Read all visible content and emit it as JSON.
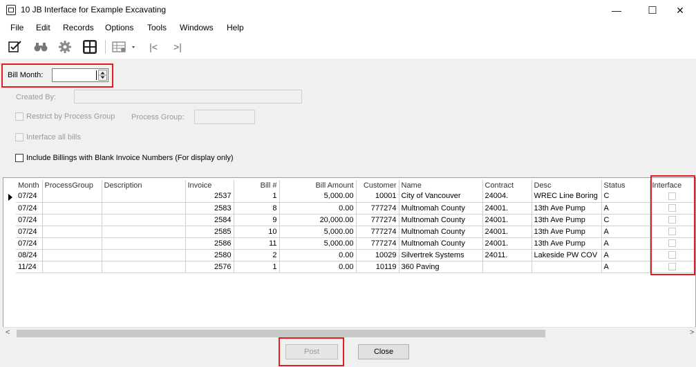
{
  "window": {
    "title": "10 JB Interface for Example Excavating",
    "minimize_glyph": "—",
    "maximize_glyph": "☐",
    "close_glyph": "✕"
  },
  "menu": [
    "File",
    "Edit",
    "Records",
    "Options",
    "Tools",
    "Windows",
    "Help"
  ],
  "toolbar": {
    "icons": [
      "edit-checklist-icon",
      "binoculars-icon",
      "gear-icon",
      "calculator-icon",
      "grid-settings-icon",
      "first-record-icon",
      "last-record-icon"
    ],
    "first_glyph": "|<",
    "last_glyph": ">|"
  },
  "form": {
    "bill_month_label": "Bill Month:",
    "bill_month_value": "",
    "created_by_label": "Created By:",
    "created_by_value": "",
    "restrict_label": "Restrict by Process Group",
    "process_group_label": "Process Group:",
    "process_group_value": "",
    "interface_all_label": "Interface all bills",
    "include_blank_label": "Include Billings with Blank Invoice Numbers  (For display only)"
  },
  "grid": {
    "columns": [
      "Month",
      "ProcessGroup",
      "Description",
      "Invoice",
      "Bill #",
      "Bill Amount",
      "Customer",
      "Name",
      "Contract",
      "Desc",
      "Status",
      "Interface"
    ],
    "rows": [
      [
        "07/24",
        "",
        "",
        "2537",
        "1",
        "5,000.00",
        "10001",
        "City of Vancouver",
        "24004.",
        "WREC Line Boring",
        "C"
      ],
      [
        "07/24",
        "",
        "",
        "2583",
        "8",
        "0.00",
        "777274",
        "Multnomah County",
        "24001.",
        "13th Ave Pump",
        "A"
      ],
      [
        "07/24",
        "",
        "",
        "2584",
        "9",
        "20,000.00",
        "777274",
        "Multnomah County",
        "24001.",
        "13th Ave Pump",
        "C"
      ],
      [
        "07/24",
        "",
        "",
        "2585",
        "10",
        "5,000.00",
        "777274",
        "Multnomah County",
        "24001.",
        "13th Ave Pump",
        "A"
      ],
      [
        "07/24",
        "",
        "",
        "2586",
        "11",
        "5,000.00",
        "777274",
        "Multnomah County",
        "24001.",
        "13th Ave Pump",
        "A"
      ],
      [
        "08/24",
        "",
        "",
        "2580",
        "2",
        "0.00",
        "10029",
        "Silvertrek Systems",
        "24011.",
        "Lakeside PW COV",
        "A"
      ],
      [
        "11/24",
        "",
        "",
        "2576",
        "1",
        "0.00",
        "10119",
        "360 Paving",
        "",
        "",
        "A"
      ]
    ],
    "scroll_left_glyph": "<",
    "scroll_right_glyph": ">"
  },
  "buttons": {
    "post": "Post",
    "close": "Close"
  },
  "colors": {
    "highlight_box": "#e31b23"
  }
}
